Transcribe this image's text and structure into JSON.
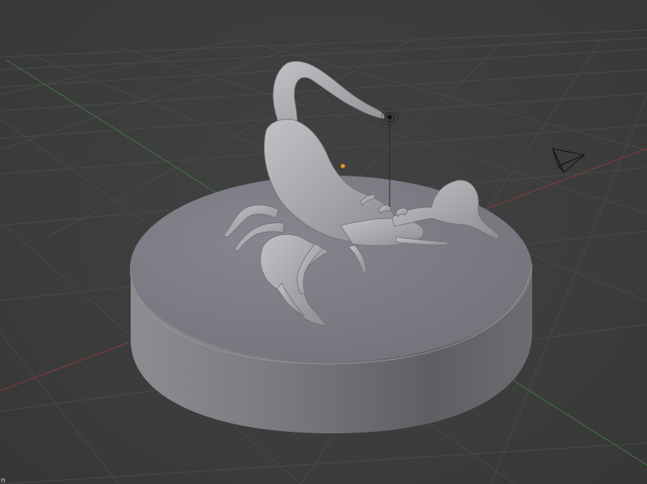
{
  "viewport": {
    "corner_label": "n",
    "colors": {
      "background": "#3d3d3d",
      "grid_line": "#4a4a4a",
      "x_axis": "#8a3a3a",
      "y_axis": "#3f7a3f",
      "mesh_light": "#a7a7ad",
      "mesh_dark": "#5d5d62",
      "origin": "#e49a2c"
    },
    "icons": [
      "camera-icon",
      "light-icon",
      "object-origin-icon"
    ]
  }
}
